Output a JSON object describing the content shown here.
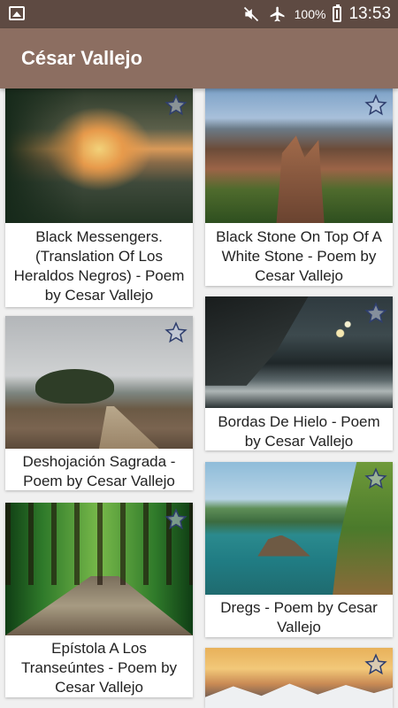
{
  "status_bar": {
    "battery_percent": "100%",
    "time": "13:53"
  },
  "app_bar": {
    "title": "César Vallejo"
  },
  "cards": [
    {
      "title": "Black Messengers. (Translation Of Los Heraldos Negros) - Poem by Cesar Vallejo",
      "image_icon": "lake-landscape",
      "favorite_icon": "star-outline"
    },
    {
      "title": "Black Stone On Top Of A White Stone - Poem by Cesar Vallejo",
      "image_icon": "rock-bridge-landscape",
      "favorite_icon": "star-outline"
    },
    {
      "title": "Deshojación Sagrada - Poem by Cesar Vallejo",
      "image_icon": "lonely-tree-landscape",
      "favorite_icon": "star-outline"
    },
    {
      "title": "Bordas De Hielo - Poem by Cesar Vallejo",
      "image_icon": "ice-shore-landscape",
      "favorite_icon": "star-outline"
    },
    {
      "title": "Epístola A Los Transeúntes - Poem by Cesar Vallejo",
      "image_icon": "forest-path-landscape",
      "favorite_icon": "star-outline"
    },
    {
      "title": "Dregs - Poem by Cesar Vallejo",
      "image_icon": "sea-cliffs-landscape",
      "favorite_icon": "star-outline"
    },
    {
      "title": "",
      "image_icon": "snowy-mountains-landscape",
      "favorite_icon": "star-outline"
    }
  ]
}
